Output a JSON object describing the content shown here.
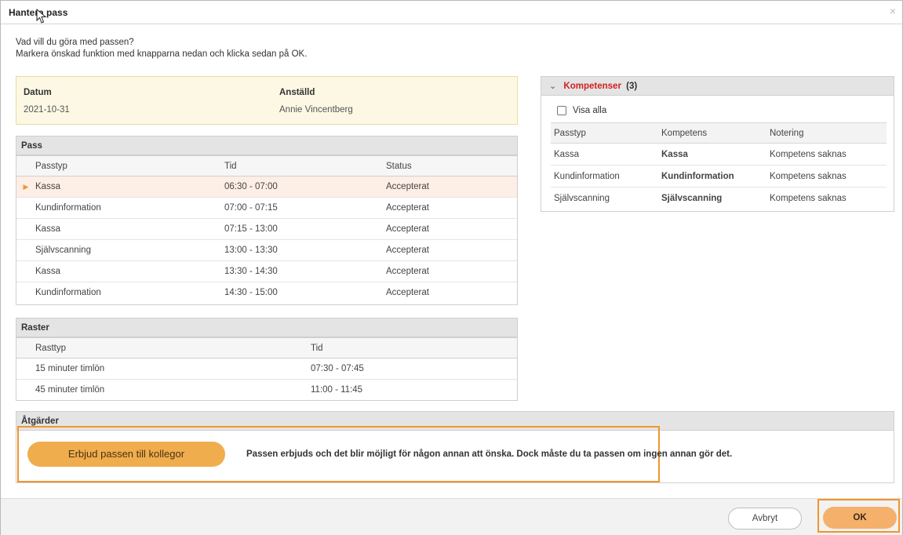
{
  "dialog": {
    "title": "Hantera pass",
    "close": "×"
  },
  "intro": {
    "line1": "Vad vill du göra med passen?",
    "line2": "Markera önskad funktion med knapparna nedan och klicka sedan på OK."
  },
  "info": {
    "date_label": "Datum",
    "date_value": "2021-10-31",
    "employee_label": "Anställd",
    "employee_value": "Annie Vincentberg"
  },
  "shifts": {
    "title": "Pass",
    "columns": [
      "Passtyp",
      "Tid",
      "Status"
    ],
    "rows": [
      {
        "type": "Kassa",
        "time": "06:30 - 07:00",
        "status": "Accepterat",
        "selected": true
      },
      {
        "type": "Kundinformation",
        "time": "07:00 - 07:15",
        "status": "Accepterat"
      },
      {
        "type": "Kassa",
        "time": "07:15 - 13:00",
        "status": "Accepterat"
      },
      {
        "type": "Självscanning",
        "time": "13:00 - 13:30",
        "status": "Accepterat"
      },
      {
        "type": "Kassa",
        "time": "13:30 - 14:30",
        "status": "Accepterat"
      },
      {
        "type": "Kundinformation",
        "time": "14:30 - 15:00",
        "status": "Accepterat"
      }
    ]
  },
  "breaks": {
    "title": "Raster",
    "columns": [
      "Rasttyp",
      "Tid"
    ],
    "rows": [
      {
        "type": "15 minuter timlön",
        "time": "07:30 - 07:45"
      },
      {
        "type": "45 minuter timlön",
        "time": "11:00 - 11:45"
      }
    ]
  },
  "competences": {
    "title": "Kompetenser",
    "count": "(3)",
    "show_all": "Visa alla",
    "columns": [
      "Passtyp",
      "Kompetens",
      "Notering"
    ],
    "rows": [
      {
        "type": "Kassa",
        "competence": "Kassa",
        "note": "Kompetens saknas"
      },
      {
        "type": "Kundinformation",
        "competence": "Kundinformation",
        "note": "Kompetens saknas"
      },
      {
        "type": "Självscanning",
        "competence": "Självscanning",
        "note": "Kompetens saknas"
      }
    ]
  },
  "actions": {
    "title": "Åtgärder",
    "offer_button": "Erbjud passen till kollegor",
    "offer_text": "Passen erbjuds och det blir möjligt för någon annan att önska. Dock måste du ta passen om ingen annan gör det."
  },
  "footer": {
    "cancel": "Avbryt",
    "ok": "OK"
  },
  "colors": {
    "accent_orange": "#f0962d",
    "button_orange": "#f0ad4e",
    "warning_red": "#d31f1f",
    "info_bg": "#fcf8e3"
  }
}
